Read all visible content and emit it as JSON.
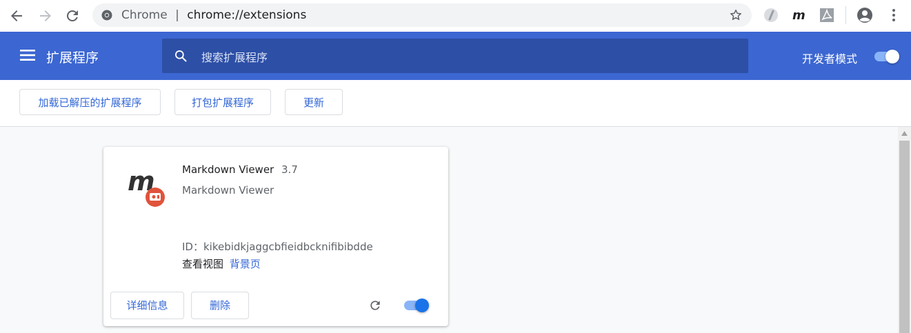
{
  "browser": {
    "omnibox_label": "Chrome",
    "separator": "|",
    "url": "chrome://extensions"
  },
  "header": {
    "title": "扩展程序",
    "search_placeholder": "搜索扩展程序",
    "dev_mode_label": "开发者模式",
    "dev_mode_on": true
  },
  "toolbar": {
    "load_unpacked": "加载已解压的扩展程序",
    "pack": "打包扩展程序",
    "update": "更新"
  },
  "extension": {
    "name": "Markdown Viewer",
    "version": "3.7",
    "description": "Markdown Viewer",
    "id_line": "ID：kikebidkjaggcbfieidbcknifibibdde",
    "inspect_label": "查看视图",
    "inspect_link": "背景页",
    "details_button": "详细信息",
    "remove_button": "删除",
    "enabled": true
  },
  "colors": {
    "header_bg": "#3c67d2",
    "accent": "#3367d6",
    "toggle_knob": "#ffffff",
    "card_toggle_knob": "#1a73e8"
  }
}
